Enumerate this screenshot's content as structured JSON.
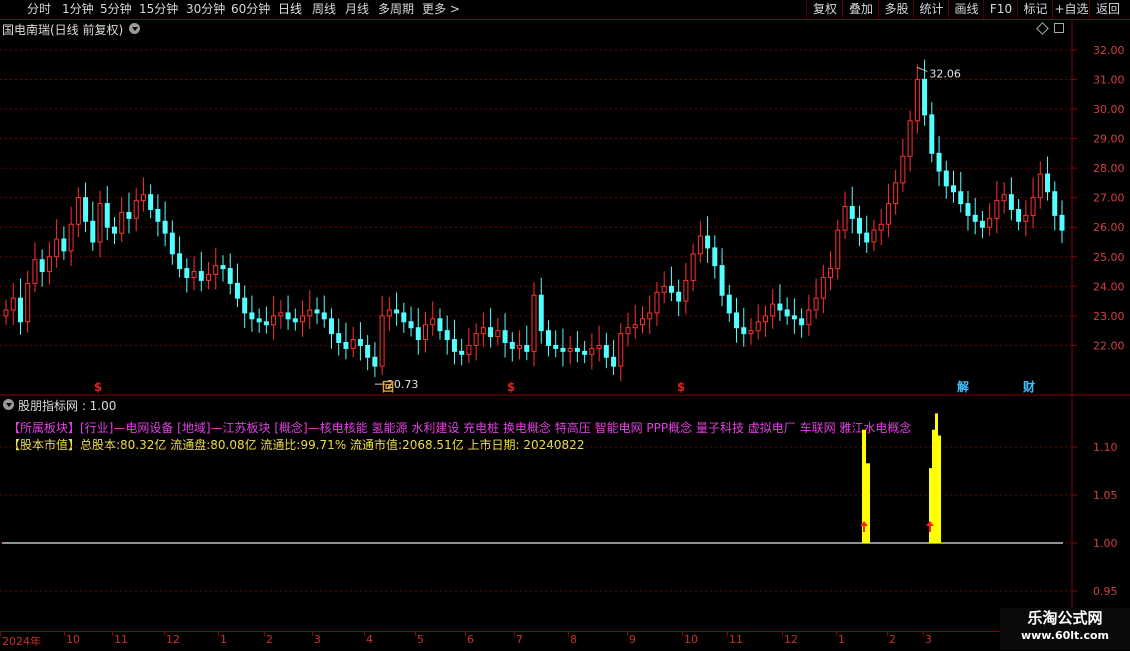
{
  "toolbar": {
    "left_items": [
      "分时",
      "1分钟",
      "5分钟",
      "15分钟",
      "30分钟",
      "60分钟",
      "日线",
      "周线",
      "月线",
      "多周期",
      "更多 >"
    ],
    "right_items": [
      "复权",
      "叠加",
      "多股",
      "统计",
      "画线",
      "F10",
      "标记",
      "+自选",
      "返回"
    ]
  },
  "stock_title": "国电南瑞(日线 前复权)",
  "price_axis": {
    "ticks": [
      "32.00",
      "31.00",
      "30.00",
      "29.00",
      "28.00",
      "27.00",
      "26.00",
      "25.00",
      "24.00",
      "23.00",
      "22.00"
    ]
  },
  "annotations": {
    "high_label": "32.06",
    "low_label": "20.73"
  },
  "event_markers": [
    {
      "text": "$",
      "color": "#e02020"
    },
    {
      "text": "回",
      "color": "#e0a040"
    },
    {
      "text": "$",
      "color": "#e02020"
    },
    {
      "text": "$",
      "color": "#e02020"
    },
    {
      "text": "解",
      "color": "#40c0ff"
    },
    {
      "text": "财",
      "color": "#40c0ff"
    }
  ],
  "indicator": {
    "title": "股朋指标网 : 1.00",
    "line1": "【所属板块】[行业]—电网设备 [地域]—江苏板块 [概念]—核电核能 氢能源 水利建设 充电桩 换电概念 特高压 智能电网 PPP概念 量子科技 虚拟电厂 车联网 雅江水电概念",
    "line2": "【股本市值】总股本:80.32亿 流通盘:80.08亿 流通比:99.71% 流通市值:2068.51亿 上市日期: 20240822",
    "axis_ticks": [
      "1.10",
      "1.05",
      "1.00",
      "0.95"
    ]
  },
  "date_axis": [
    "2024年",
    "10",
    "11",
    "12",
    "1",
    "2",
    "3",
    "4",
    "5",
    "6",
    "7",
    "8",
    "9",
    "10",
    "11",
    "12",
    "1",
    "2",
    "3"
  ],
  "watermark": {
    "line1": "乐淘公式网",
    "line2": "www.60lt.com"
  },
  "colors": {
    "up": "#ff3030",
    "down": "#54ffff",
    "signal_bar": "#ffff00",
    "grid": "#8a0000"
  },
  "chart_data": {
    "type": "candlestick",
    "ylim": [
      21.0,
      32.3
    ],
    "closes": [
      23.2,
      23.6,
      22.8,
      24.1,
      24.9,
      24.5,
      25.0,
      25.6,
      25.2,
      26.1,
      27.0,
      26.2,
      25.5,
      26.8,
      26.0,
      25.8,
      26.5,
      26.3,
      26.9,
      27.1,
      26.6,
      26.2,
      25.8,
      25.1,
      24.6,
      24.3,
      24.5,
      24.2,
      24.4,
      24.7,
      24.6,
      24.1,
      23.6,
      23.1,
      22.9,
      22.8,
      22.7,
      23.0,
      23.1,
      22.9,
      22.8,
      23.0,
      23.2,
      23.1,
      22.9,
      22.4,
      22.1,
      21.9,
      22.2,
      22.0,
      21.6,
      21.3,
      23.0,
      23.2,
      23.1,
      22.8,
      22.6,
      22.2,
      22.7,
      22.9,
      22.5,
      22.2,
      21.8,
      21.7,
      22.0,
      22.4,
      22.6,
      22.3,
      22.5,
      22.1,
      21.9,
      22.0,
      21.8,
      23.7,
      22.5,
      22.0,
      21.9,
      21.8,
      21.9,
      21.8,
      21.7,
      21.9,
      22.0,
      21.6,
      21.3,
      22.4,
      22.6,
      22.7,
      22.9,
      23.1,
      23.8,
      24.0,
      23.8,
      23.5,
      24.2,
      25.1,
      25.7,
      25.3,
      24.7,
      23.7,
      23.1,
      22.6,
      22.4,
      22.5,
      22.8,
      23.0,
      23.4,
      23.2,
      23.0,
      22.9,
      22.7,
      23.2,
      23.6,
      24.3,
      24.6,
      25.9,
      26.7,
      26.3,
      25.8,
      25.5,
      25.9,
      26.1,
      26.8,
      27.5,
      28.4,
      29.6,
      31.0,
      29.8,
      28.5,
      27.9,
      27.4,
      27.2,
      26.8,
      26.4,
      26.2,
      26.0,
      26.3,
      26.9,
      27.1,
      26.6,
      26.2,
      26.4,
      27.0,
      27.8,
      27.2,
      26.4,
      25.9
    ]
  }
}
